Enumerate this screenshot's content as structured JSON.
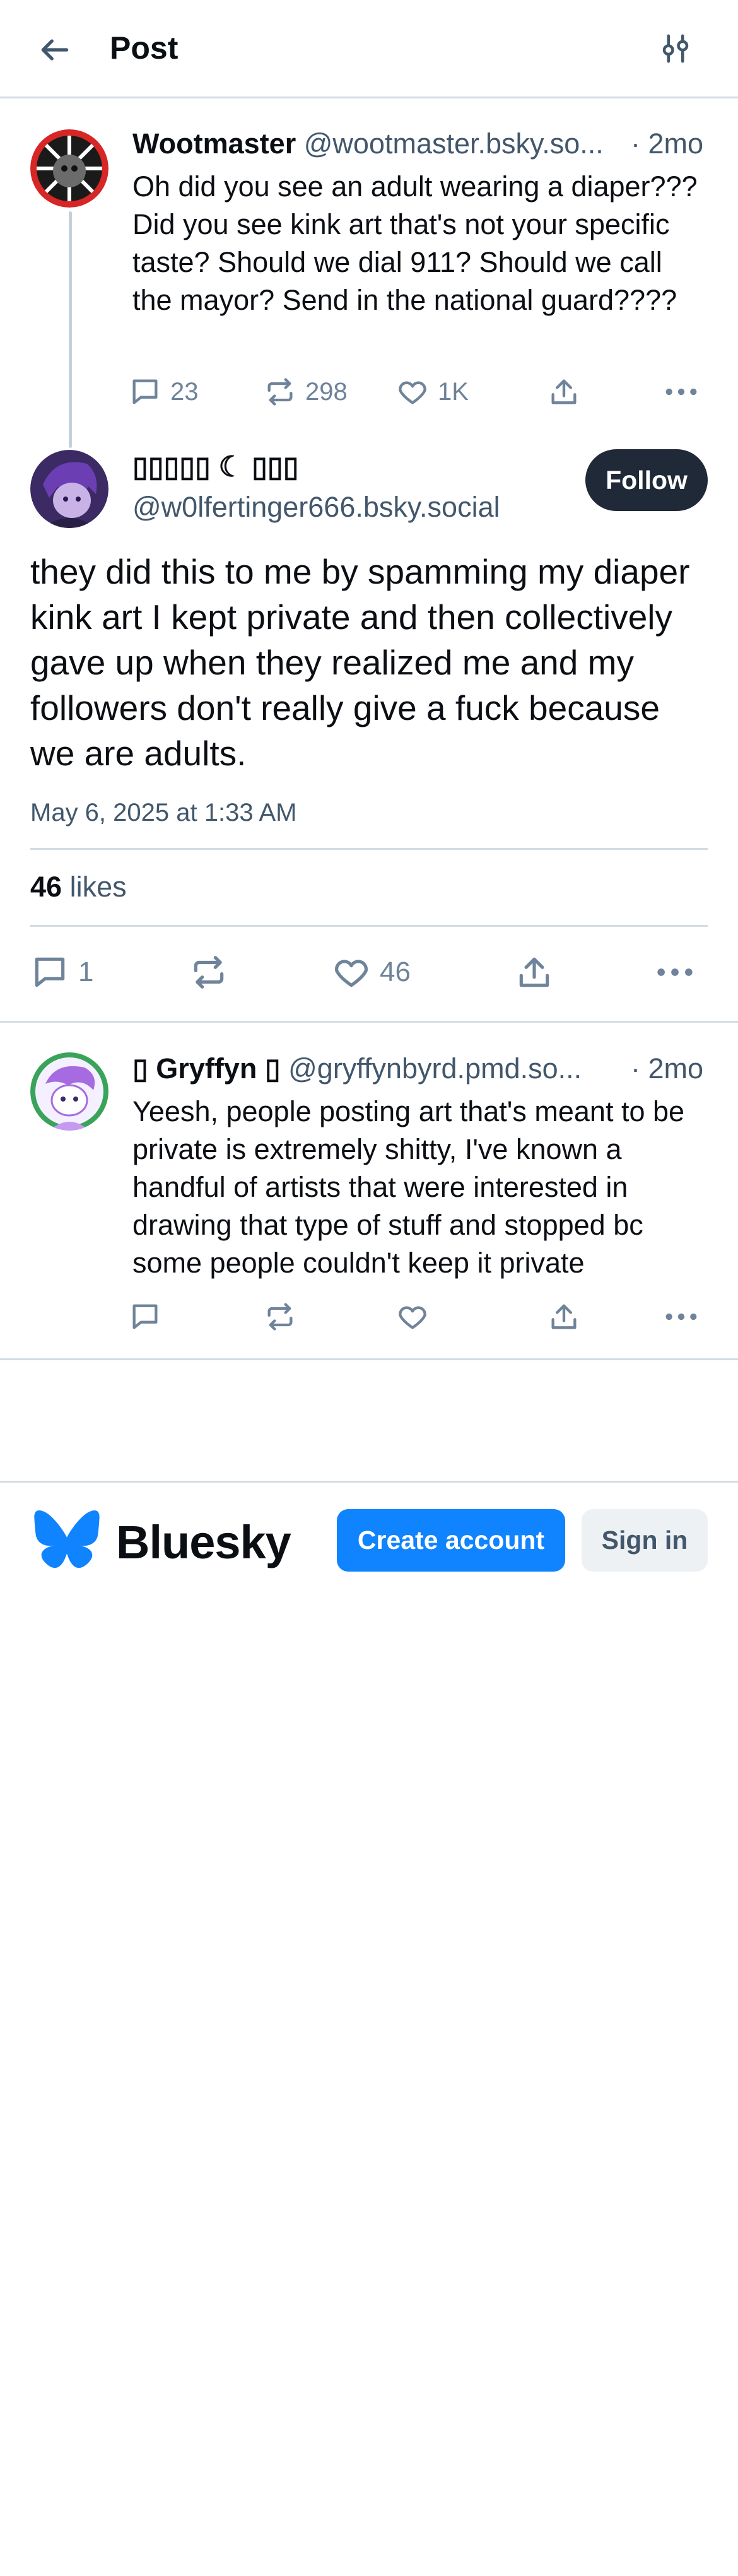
{
  "header": {
    "title": "Post",
    "back_icon": "arrow-left-icon",
    "filter_icon": "sliders-icon"
  },
  "parent_post": {
    "display_name": "Wootmaster",
    "handle": "@wootmaster.bsky.so...",
    "time": "· 2mo",
    "text": "Oh did you see an adult wearing a diaper??? Did you see kink art that's not your specific taste? Should we dial 911? Should we call the mayor? Send in the national guard????",
    "replies": "23",
    "reposts": "298",
    "likes": "1K"
  },
  "main_post": {
    "display_name": "▯▯▯▯▯ ☾ ▯▯▯",
    "handle": "@w0lfertinger666.bsky.social",
    "follow_label": "Follow",
    "text": "they did this to me by spamming my diaper kink art I kept private and then collectively gave up when they realized me and my followers don't really give a fuck because we are adults.",
    "date": "May 6, 2025 at 1:33 AM",
    "likes_count": "46",
    "likes_label": "likes",
    "replies": "1",
    "like_count_action": "46"
  },
  "reply_post": {
    "display_name": "Gryffyn",
    "name_prefix": "▯",
    "name_suffix": "▯",
    "handle": "@gryffynbyrd.pmd.so...",
    "time": "· 2mo",
    "text": "Yeesh, people posting art that's meant to be private is extremely shitty, I've known a handful of artists that were interested in drawing that type of stuff and stopped bc some people couldn't keep it private"
  },
  "footer": {
    "brand": "Bluesky",
    "create_account": "Create account",
    "sign_in": "Sign in"
  },
  "colors": {
    "accent": "#1083fe",
    "muted": "#42576c",
    "icon": "#6f839a",
    "divider": "#d4dbe2",
    "follow_bg": "#1f2937"
  }
}
